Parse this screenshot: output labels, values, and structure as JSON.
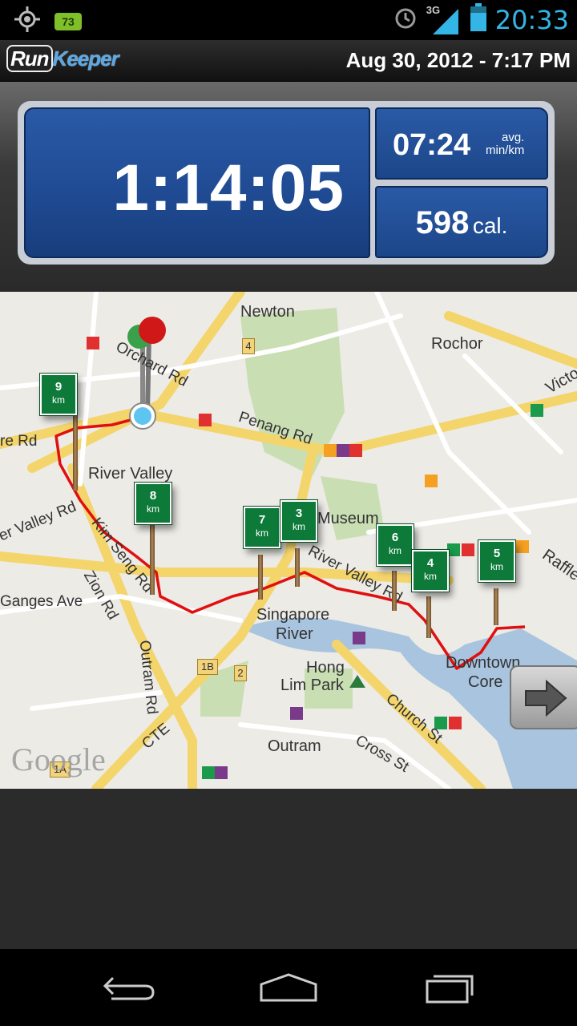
{
  "status_bar": {
    "notification_count": "73",
    "network": "3G",
    "time": "20:33",
    "icons": [
      "gps-icon",
      "notification-badge",
      "alarm-icon",
      "signal-icon",
      "battery-icon"
    ]
  },
  "header": {
    "logo_run": "Run",
    "logo_keeper": "Keeper",
    "date": "Aug 30, 2012 - 7:17 PM"
  },
  "stats": {
    "duration": "1:14:05",
    "pace": "07:24",
    "pace_unit_top": "avg.",
    "pace_unit_bottom": "min/km",
    "calories": "598",
    "calories_unit": "cal."
  },
  "map": {
    "labels": [
      "Newton",
      "Rochor",
      "River Valley",
      "Museum",
      "Singapore",
      "River",
      "Hong",
      "Lim Park",
      "Downtown",
      "Core",
      "Outram",
      "Victo",
      "Raffle"
    ],
    "roads": [
      "Orchard Rd",
      "Penang Rd",
      "re Rd",
      "er Valley Rd",
      "Kim Seng Rd",
      "Zion Rd",
      "Ganges Ave",
      "Outram Rd",
      "CTE",
      "Church St",
      "Cross St",
      "River Valley Rd"
    ],
    "hwy_markers": [
      "4",
      "1B",
      "2",
      "1A"
    ],
    "km_markers": [
      "9",
      "8",
      "7",
      "3",
      "6",
      "4",
      "5"
    ],
    "km_unit": "km",
    "attribution": "Google"
  },
  "colors": {
    "route": "#e01010",
    "panel_blue": "#1f4a92",
    "status_time": "#33b5e5"
  }
}
